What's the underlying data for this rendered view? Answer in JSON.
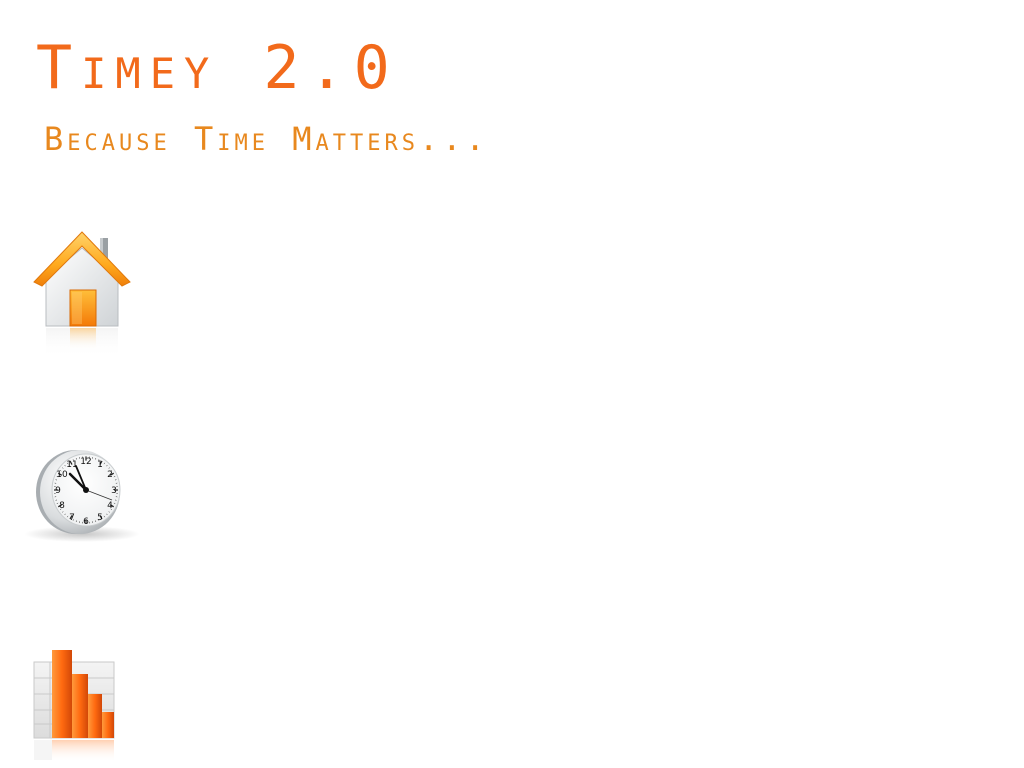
{
  "app": {
    "title": "Timey 2.0",
    "tagline": "Because Time Matters...",
    "accent_color": "#f26a1b",
    "tagline_color": "#e8881e"
  },
  "nav": {
    "items": [
      {
        "id": "home",
        "icon": "home-icon"
      },
      {
        "id": "clock",
        "icon": "clock-icon"
      },
      {
        "id": "reports",
        "icon": "bar-chart-icon"
      }
    ]
  }
}
